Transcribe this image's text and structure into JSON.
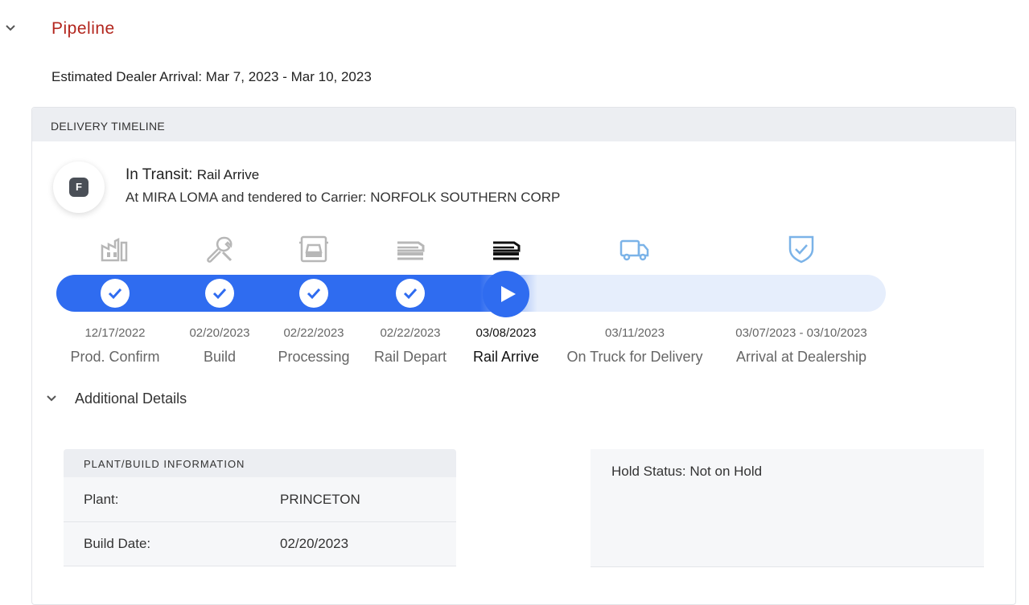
{
  "section": {
    "title": "Pipeline"
  },
  "eta": {
    "label": "Estimated Dealer Arrival: Mar 7, 2023 - Mar 10, 2023"
  },
  "card": {
    "header": "DELIVERY TIMELINE"
  },
  "brand": {
    "badge": "F"
  },
  "status": {
    "main": "In Transit:",
    "sub": "Rail Arrive",
    "detail": "At MIRA LOMA and tendered to Carrier: NORFOLK SOUTHERN CORP"
  },
  "timeline": {
    "progress_fraction": 0.58,
    "current_index": 4,
    "completed_count": 4,
    "colors": {
      "accent": "#2f6cf0",
      "track": "#e6eefc",
      "future_icon": "#7bb3e8",
      "done_icon": "#b7b7b7"
    },
    "steps": [
      {
        "label": "Prod. Confirm",
        "date": "12/17/2022",
        "icon": "factory-icon"
      },
      {
        "label": "Build",
        "date": "02/20/2023",
        "icon": "wrench-icon"
      },
      {
        "label": "Processing",
        "date": "02/22/2023",
        "icon": "car-front-icon"
      },
      {
        "label": "Rail Depart",
        "date": "02/22/2023",
        "icon": "rail-car-icon"
      },
      {
        "label": "Rail Arrive",
        "date": "03/08/2023",
        "icon": "rail-car-icon"
      },
      {
        "label": "On Truck for Delivery",
        "date": "03/11/2023",
        "icon": "truck-icon"
      },
      {
        "label": "Arrival at Dealership",
        "date": "03/07/2023 - 03/10/2023",
        "icon": "shield-check-icon"
      }
    ]
  },
  "details": {
    "label": "Additional Details"
  },
  "plant_info": {
    "header": "PLANT/BUILD INFORMATION",
    "rows": [
      {
        "key": "Plant:",
        "value": "PRINCETON"
      },
      {
        "key": "Build Date:",
        "value": "02/20/2023"
      }
    ]
  },
  "hold": {
    "status": "Hold Status: Not on Hold"
  }
}
